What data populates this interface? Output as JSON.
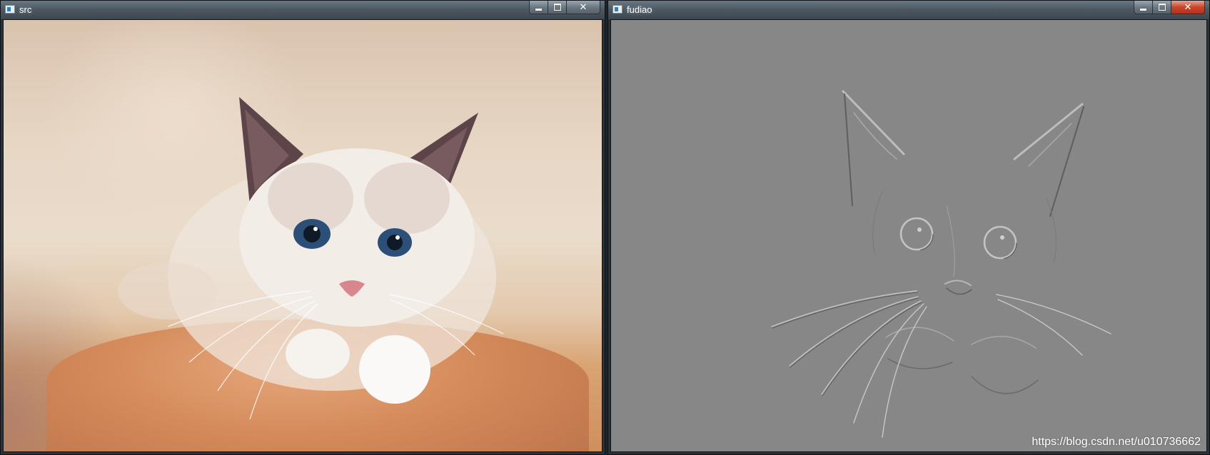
{
  "windows": [
    {
      "title": "src",
      "content": "original-photo"
    },
    {
      "title": "fudiao",
      "content": "embossed-photo"
    }
  ],
  "watermark": "https://blog.csdn.net/u010736662",
  "caption_icons": [
    "minimize-icon",
    "maximize-icon",
    "close-icon"
  ],
  "colors": {
    "emboss_gray": "#878787",
    "close_red": "#c9452c",
    "titlebar": "#4d5962"
  }
}
